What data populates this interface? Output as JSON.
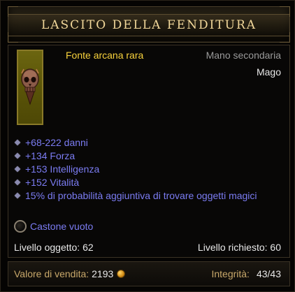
{
  "header": {
    "title": "LASCITO DELLA FENDITURA"
  },
  "item": {
    "icon": "skull-orb-icon",
    "type": "Fonte arcana rara",
    "slot": "Mano secondaria",
    "class": "Mago",
    "affixes": [
      "+68-222 danni",
      "+134 Forza",
      "+153 Intelligenza",
      "+152 Vitalità",
      "15% di probabilità aggiuntiva di trovare oggetti magici"
    ],
    "socket": "Castone vuoto",
    "item_level_label": "Livello oggetto:",
    "item_level": "62",
    "required_level_label": "Livello richiesto:",
    "required_level": "60"
  },
  "footer": {
    "sell_label": "Valore di vendita:",
    "sell_value": "2193",
    "durability_label": "Integrità:",
    "durability_value": "43/43"
  },
  "colors": {
    "title": "#f2d89a",
    "rare_yellow": "#f8d23c",
    "magic_blue": "#7b7cf2",
    "label_gold": "#c8a86a"
  }
}
